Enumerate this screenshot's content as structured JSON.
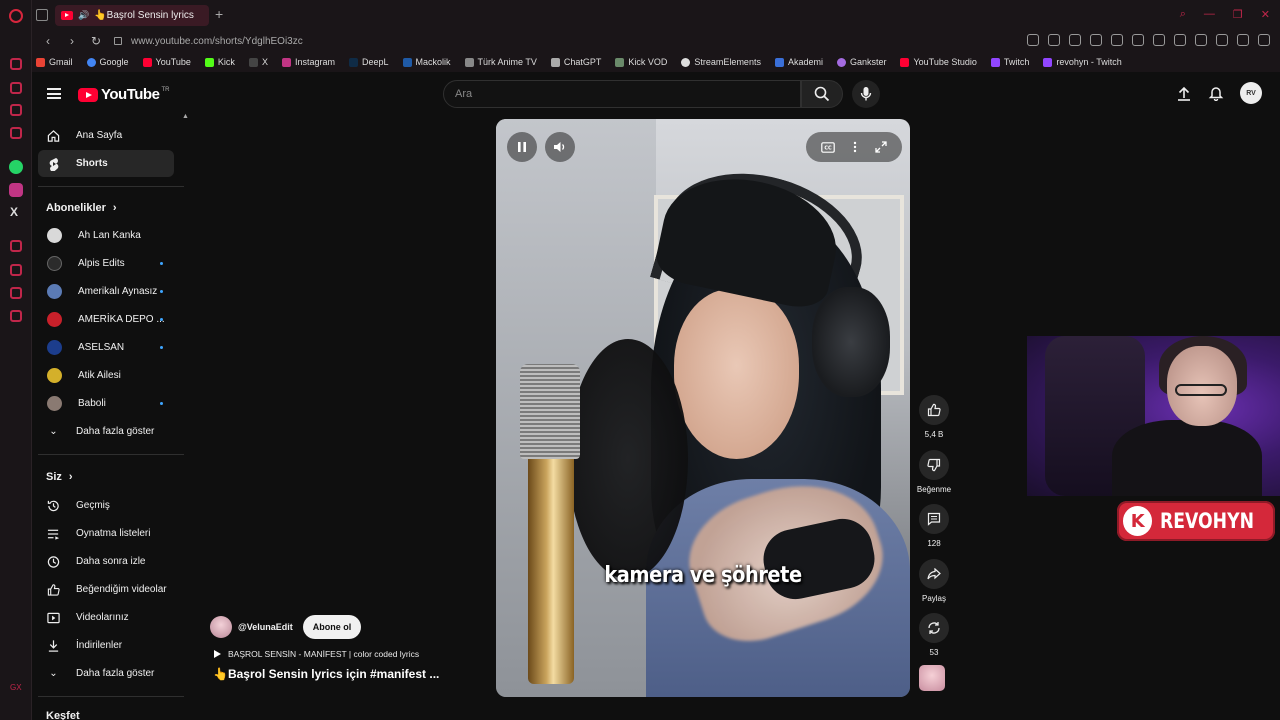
{
  "browser": {
    "tab_title": "👆Başrol Sensin lyrics",
    "url": "www.youtube.com/shorts/YdglhEOi3zc",
    "bookmarks": [
      "Gmail",
      "Google",
      "YouTube",
      "Kick",
      "X",
      "Instagram",
      "DeepL",
      "Mackolik",
      "Türk Anime TV",
      "ChatGPT",
      "Kick VOD",
      "StreamElements",
      "Akademi",
      "Gankster",
      "YouTube Studio",
      "Twitch",
      "revohyn - Twitch"
    ]
  },
  "header": {
    "logo_text": "YouTube",
    "logo_sup": "TR",
    "search_placeholder": "Ara",
    "avatar_text": "RV"
  },
  "sidebar": {
    "home": "Ana Sayfa",
    "shorts": "Shorts",
    "subscriptions_title": "Abonelikler",
    "subscriptions": [
      {
        "name": "Ah Lan Kanka",
        "color": "#d9d9d9",
        "new": false
      },
      {
        "name": "Alpis Edits",
        "color": "#2b2b2b",
        "new": true
      },
      {
        "name": "Amerikalı Aynasız",
        "color": "#5b7bb5",
        "new": true
      },
      {
        "name": "AMERİKA DEPO ...",
        "color": "#c8202a",
        "new": true
      },
      {
        "name": "ASELSAN",
        "color": "#1c3d8c",
        "new": true
      },
      {
        "name": "Atik Ailesi",
        "color": "#d4b02a",
        "new": false
      },
      {
        "name": "Baboli",
        "color": "#8a7a72",
        "new": true
      }
    ],
    "show_more_subs": "Daha fazla göster",
    "you_title": "Siz",
    "you_items": [
      "Geçmiş",
      "Oynatma listeleri",
      "Daha sonra izle",
      "Beğendiğim videolar",
      "Videolarınız",
      "İndirilenler",
      "Daha fazla göster"
    ],
    "explore_title": "Keşfet"
  },
  "short": {
    "caption": "kamera ve şöhrete",
    "channel": "@VelunaEdit",
    "subscribe": "Abone ol",
    "song": "BAŞROL SENSİN - MANİFEST | color coded lyrics",
    "title": "👆Başrol Sensin lyrics için #manifest ..."
  },
  "actions": {
    "likes": "5,4 B",
    "dislike_label": "Beğenme",
    "comments": "128",
    "share_label": "Paylaş",
    "remix": "53"
  },
  "overlay": {
    "brand_letter": "K",
    "brand_name": "REVOHYN",
    "brand_color": "#d4283a"
  }
}
